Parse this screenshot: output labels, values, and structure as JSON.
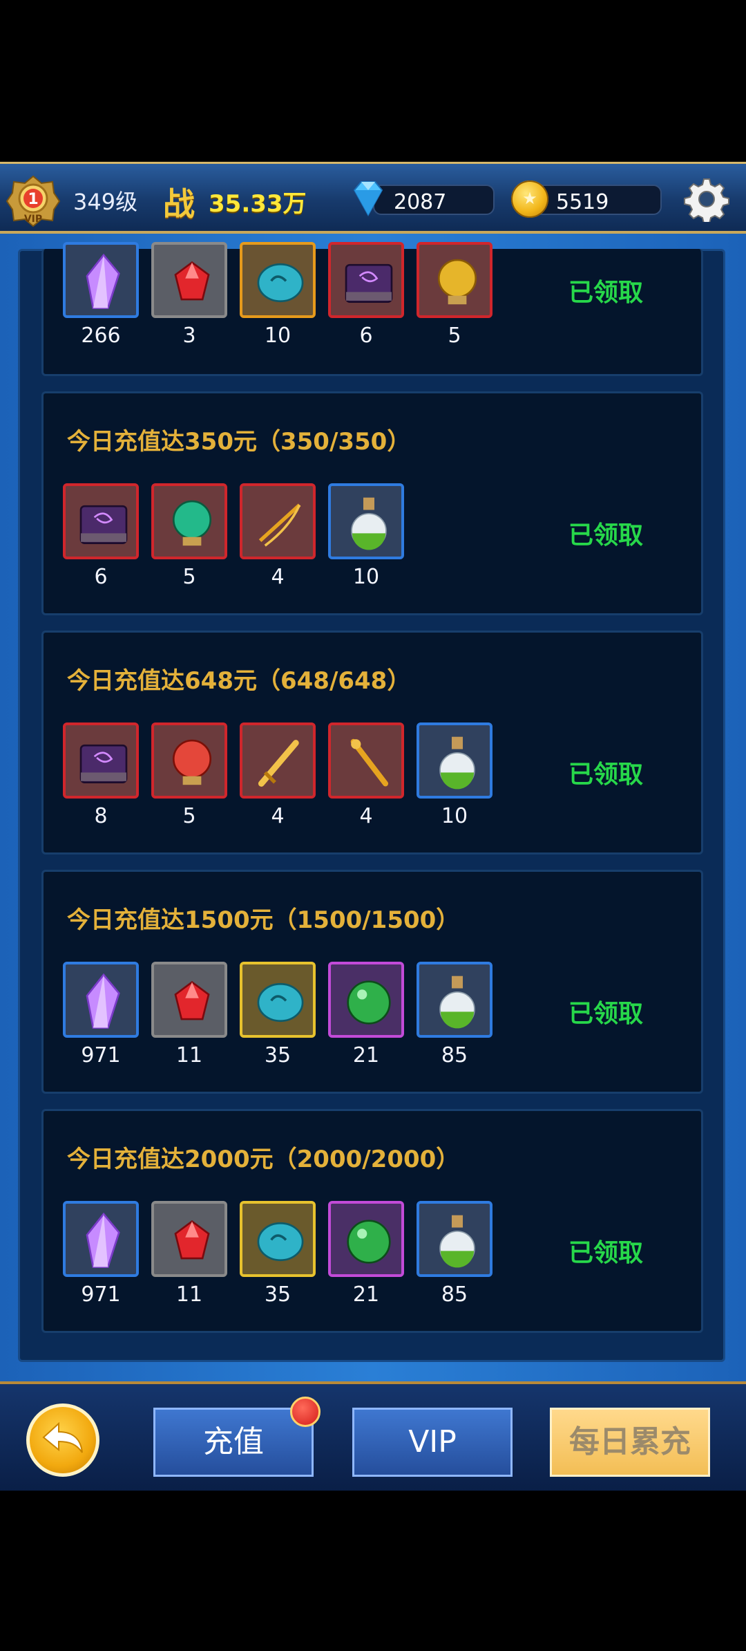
{
  "header": {
    "vip_level": "1",
    "player_level": "349级",
    "power_label": "战",
    "power_value": "35.33万",
    "diamonds": "2087",
    "gold": "5519"
  },
  "top_card": {
    "status": "已领取",
    "items": [
      {
        "icon": "purple-crystal-icon",
        "qty": "266",
        "frame": "blue"
      },
      {
        "icon": "red-gem-icon",
        "qty": "3",
        "frame": "gray"
      },
      {
        "icon": "cyan-stone-icon",
        "qty": "10",
        "frame": "orange"
      },
      {
        "icon": "purple-book-icon",
        "qty": "6",
        "frame": "red"
      },
      {
        "icon": "gold-orb-icon",
        "qty": "5",
        "frame": "red"
      }
    ]
  },
  "cards": [
    {
      "title": "今日充值达350元（350/350）",
      "status": "已领取",
      "items": [
        {
          "icon": "purple-book-icon",
          "qty": "6",
          "frame": "red"
        },
        {
          "icon": "green-orb-icon",
          "qty": "5",
          "frame": "red"
        },
        {
          "icon": "golden-bow-icon",
          "qty": "4",
          "frame": "red"
        },
        {
          "icon": "green-potion-icon",
          "qty": "10",
          "frame": "blue"
        }
      ]
    },
    {
      "title": "今日充值达648元（648/648）",
      "status": "已领取",
      "items": [
        {
          "icon": "purple-book-icon",
          "qty": "8",
          "frame": "red"
        },
        {
          "icon": "red-orb-icon",
          "qty": "5",
          "frame": "red"
        },
        {
          "icon": "golden-sword-icon",
          "qty": "4",
          "frame": "red"
        },
        {
          "icon": "golden-staff-icon",
          "qty": "4",
          "frame": "red"
        },
        {
          "icon": "green-potion-icon",
          "qty": "10",
          "frame": "blue"
        }
      ]
    },
    {
      "title": "今日充值达1500元（1500/1500）",
      "status": "已领取",
      "items": [
        {
          "icon": "purple-crystal-icon",
          "qty": "971",
          "frame": "blue"
        },
        {
          "icon": "red-gem-icon",
          "qty": "11",
          "frame": "gray"
        },
        {
          "icon": "cyan-stone-icon",
          "qty": "35",
          "frame": "yellow"
        },
        {
          "icon": "green-sphere-icon",
          "qty": "21",
          "frame": "purple"
        },
        {
          "icon": "green-potion-icon",
          "qty": "85",
          "frame": "blue"
        }
      ]
    },
    {
      "title": "今日充值达2000元（2000/2000）",
      "status": "已领取",
      "items": [
        {
          "icon": "purple-crystal-icon",
          "qty": "971",
          "frame": "blue"
        },
        {
          "icon": "red-gem-icon",
          "qty": "11",
          "frame": "gray"
        },
        {
          "icon": "cyan-stone-icon",
          "qty": "35",
          "frame": "yellow"
        },
        {
          "icon": "green-sphere-icon",
          "qty": "21",
          "frame": "purple"
        },
        {
          "icon": "green-potion-icon",
          "qty": "85",
          "frame": "blue"
        }
      ]
    }
  ],
  "bottom_nav": {
    "recharge_label": "充值",
    "vip_label": "VIP",
    "daily_label": "每日累充"
  }
}
